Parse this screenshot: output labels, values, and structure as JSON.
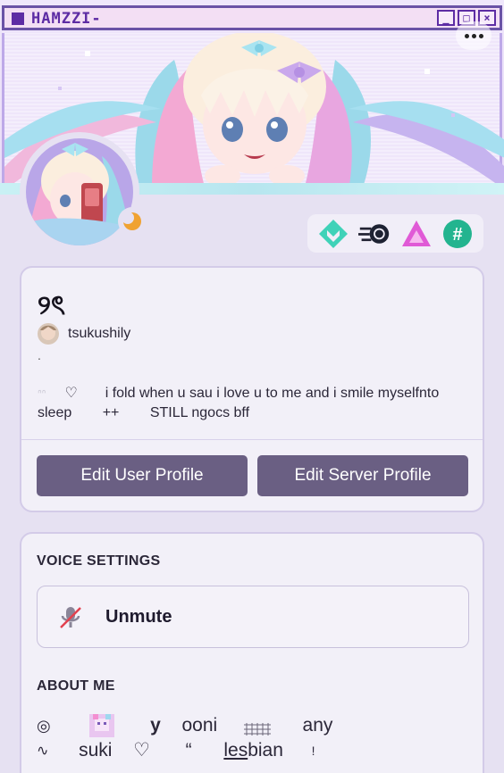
{
  "window": {
    "title": "HAMZZI-",
    "buttons": [
      "_",
      "□",
      "×"
    ]
  },
  "profile": {
    "display_name": "୨ৎ",
    "username": "tsukushily",
    "dot": ".",
    "bio_line1_a": "♡",
    "bio_line1_b": "i fold when u sau i love u to me and i smile myselfnto",
    "bio_line2_a": "sleep",
    "bio_line2_b": "++",
    "bio_line2_c": "STILL ngocs bff"
  },
  "buttons": {
    "edit_user": "Edit User Profile",
    "edit_server": "Edit Server Profile"
  },
  "voice": {
    "title": "VOICE SETTINGS",
    "unmute": "Unmute"
  },
  "about": {
    "title": "ABOUT ME",
    "line1": [
      "◎",
      "y",
      "ooni",
      "any"
    ],
    "line2": [
      "∿",
      "suki",
      "♡",
      "“",
      "les",
      "bian",
      "!"
    ]
  },
  "colors": {
    "accent_button": "#6a5f83",
    "page_bg": "#e6e1f2",
    "card_bg": "#f2f0f8",
    "window_border": "#6a53a6"
  },
  "badges": [
    "hypesquad-balance-icon",
    "speed-boost-icon",
    "triangle-quest-icon",
    "hashtag-badge-icon"
  ]
}
